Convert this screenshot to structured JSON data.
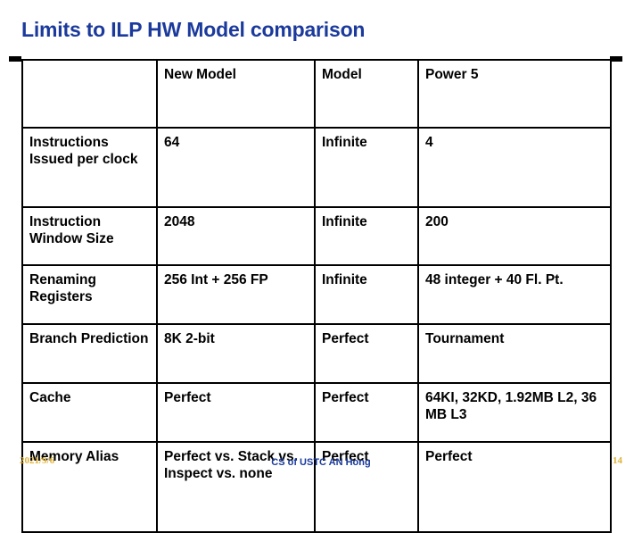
{
  "slide": {
    "title": "Limits to ILP HW Model comparison",
    "title_color": "#1b3a9c",
    "highlight_color": "#c00000",
    "footer_accent_color": "#e0b238"
  },
  "table": {
    "columns": [
      "",
      "New Model",
      "Model",
      "Power 5"
    ],
    "rows": [
      {
        "feature": "Instructions Issued per clock",
        "new_model": "64",
        "new_model_highlight": true,
        "model": "Infinite",
        "power5": "4"
      },
      {
        "feature": "Instruction Window Size",
        "new_model": "2048",
        "new_model_highlight": true,
        "model": "Infinite",
        "power5": "200"
      },
      {
        "feature": "Renaming Registers",
        "new_model": "256 Int + 256 FP",
        "new_model_highlight": true,
        "model": "Infinite",
        "power5": "48 integer + 40 Fl. Pt."
      },
      {
        "feature": "Branch Prediction",
        "new_model": "8K 2-bit",
        "new_model_highlight": true,
        "model": "Perfect",
        "power5": "Tournament"
      },
      {
        "feature": "Cache",
        "new_model": "Perfect",
        "new_model_highlight": false,
        "model": "Perfect",
        "power5": "64KI, 32KD, 1.92MB L2, 36 MB L3"
      },
      {
        "feature": "Memory Alias",
        "new_model": "Perfect vs. Stack vs. Inspect vs. none",
        "new_model_highlight": true,
        "model": "Perfect",
        "power5": "Perfect"
      }
    ]
  },
  "footer": {
    "date": "2021/9/6",
    "center": "CS of USTC AN Hong",
    "page_number": "14"
  }
}
